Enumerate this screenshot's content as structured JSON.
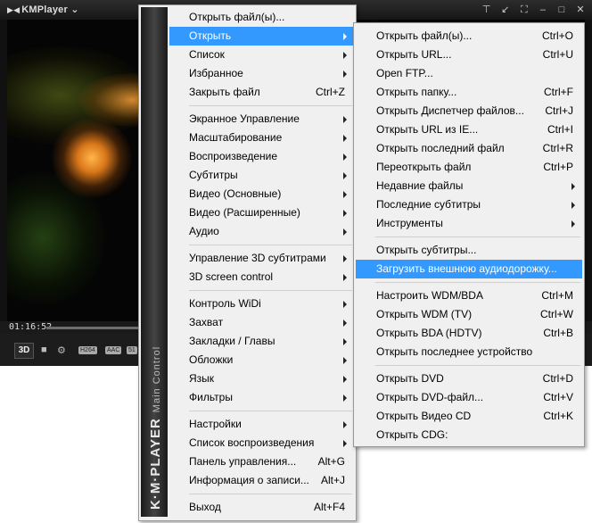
{
  "player": {
    "title": "KMPlayer",
    "title_arrow": "⌄",
    "time": "01:16:52",
    "btn_3d": "3D",
    "badges": [
      "H264",
      "AAC",
      "51"
    ],
    "seek_progress": 0.36
  },
  "main_menu": {
    "side_label_big": "K·M·PLAYER",
    "side_label_small": "Main Control",
    "items": [
      {
        "label": "Открыть файл(ы)...",
        "shortcut": "",
        "submenu": false
      },
      {
        "label": "Открыть",
        "shortcut": "",
        "submenu": true,
        "active": true
      },
      {
        "label": "Список",
        "shortcut": "",
        "submenu": true
      },
      {
        "label": "Избранное",
        "shortcut": "",
        "submenu": true
      },
      {
        "label": "Закрыть файл",
        "shortcut": "Ctrl+Z",
        "submenu": false
      },
      {
        "label": "Экранное Управление",
        "shortcut": "",
        "submenu": true
      },
      {
        "label": "Масштабирование",
        "shortcut": "",
        "submenu": true
      },
      {
        "label": "Воспроизведение",
        "shortcut": "",
        "submenu": true
      },
      {
        "label": "Субтитры",
        "shortcut": "",
        "submenu": true
      },
      {
        "label": "Видео (Основные)",
        "shortcut": "",
        "submenu": true
      },
      {
        "label": "Видео (Расширенные)",
        "shortcut": "",
        "submenu": true
      },
      {
        "label": "Аудио",
        "shortcut": "",
        "submenu": true
      },
      {
        "label": "Управление 3D субтитрами",
        "shortcut": "",
        "submenu": true
      },
      {
        "label": "3D screen control",
        "shortcut": "",
        "submenu": true
      },
      {
        "label": "Контроль WiDi",
        "shortcut": "",
        "submenu": true
      },
      {
        "label": "Захват",
        "shortcut": "",
        "submenu": true
      },
      {
        "label": "Закладки / Главы",
        "shortcut": "",
        "submenu": true
      },
      {
        "label": "Обложки",
        "shortcut": "",
        "submenu": true
      },
      {
        "label": "Язык",
        "shortcut": "",
        "submenu": true
      },
      {
        "label": "Фильтры",
        "shortcut": "",
        "submenu": true
      },
      {
        "label": "Настройки",
        "shortcut": "",
        "submenu": true
      },
      {
        "label": "Список воспроизведения",
        "shortcut": "",
        "submenu": true
      },
      {
        "label": "Панель управления...",
        "shortcut": "Alt+G",
        "submenu": false
      },
      {
        "label": "Информация о записи...",
        "shortcut": "Alt+J",
        "submenu": false
      },
      {
        "label": "Выход",
        "shortcut": "Alt+F4",
        "submenu": false
      }
    ]
  },
  "sub_menu": {
    "items": [
      {
        "label": "Открыть файл(ы)...",
        "shortcut": "Ctrl+O",
        "submenu": false
      },
      {
        "label": "Открыть URL...",
        "shortcut": "Ctrl+U",
        "submenu": false
      },
      {
        "label": "Open FTP...",
        "shortcut": "",
        "submenu": false
      },
      {
        "label": "Открыть папку...",
        "shortcut": "Ctrl+F",
        "submenu": false
      },
      {
        "label": "Открыть Диспетчер файлов...",
        "shortcut": "Ctrl+J",
        "submenu": false
      },
      {
        "label": "Открыть URL из IE...",
        "shortcut": "Ctrl+I",
        "submenu": false
      },
      {
        "label": "Открыть последний файл",
        "shortcut": "Ctrl+R",
        "submenu": false
      },
      {
        "label": "Переоткрыть файл",
        "shortcut": "Ctrl+P",
        "submenu": false
      },
      {
        "label": "Недавние файлы",
        "shortcut": "",
        "submenu": true
      },
      {
        "label": "Последние субтитры",
        "shortcut": "",
        "submenu": true
      },
      {
        "label": "Инструменты",
        "shortcut": "",
        "submenu": true
      },
      {
        "label": "Открыть субтитры...",
        "shortcut": "",
        "submenu": false
      },
      {
        "label": "Загрузить внешнюю аудиодорожку...",
        "shortcut": "",
        "submenu": false,
        "active": true
      },
      {
        "label": "Настроить WDM/BDA",
        "shortcut": "Ctrl+M",
        "submenu": false
      },
      {
        "label": "Открыть WDM (TV)",
        "shortcut": "Ctrl+W",
        "submenu": false
      },
      {
        "label": "Открыть BDA (HDTV)",
        "shortcut": "Ctrl+B",
        "submenu": false
      },
      {
        "label": "Открыть последнее устройство",
        "shortcut": "",
        "submenu": false
      },
      {
        "label": "Открыть DVD",
        "shortcut": "Ctrl+D",
        "submenu": false
      },
      {
        "label": "Открыть DVD-файл...",
        "shortcut": "Ctrl+V",
        "submenu": false
      },
      {
        "label": "Открыть Видео CD",
        "shortcut": "Ctrl+K",
        "submenu": false
      },
      {
        "label": "Открыть CDG:",
        "shortcut": "",
        "submenu": false
      }
    ]
  }
}
